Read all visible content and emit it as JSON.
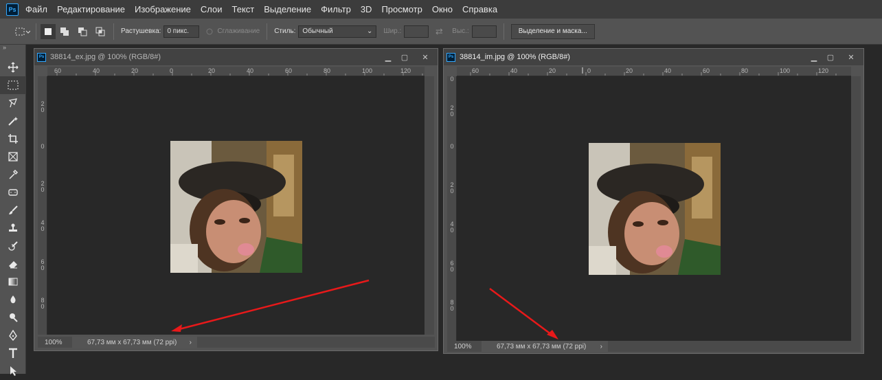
{
  "menu": {
    "items": [
      "Файл",
      "Редактирование",
      "Изображение",
      "Слои",
      "Текст",
      "Выделение",
      "Фильтр",
      "3D",
      "Просмотр",
      "Окно",
      "Справка"
    ],
    "logo": "Ps"
  },
  "options": {
    "feather_label": "Растушевка:",
    "feather_value": "0 пикс.",
    "antialias_label": "Сглаживание",
    "style_label": "Стиль:",
    "style_value": "Обычный",
    "width_label": "Шир.:",
    "height_label": "Выс.:",
    "select_mask_label": "Выделение и маска..."
  },
  "tools": [
    "move-icon",
    "marquee-icon",
    "lasso-icon",
    "magic-wand-icon",
    "crop-icon",
    "frame-icon",
    "eyedropper-icon",
    "healing-brush-icon",
    "brush-icon",
    "clone-stamp-icon",
    "history-brush-icon",
    "eraser-icon",
    "gradient-icon",
    "blur-icon",
    "dodge-icon",
    "pen-icon",
    "type-icon"
  ],
  "windows": [
    {
      "title": "38814_ex.jpg @ 100% (RGB/8#)",
      "zoom": "100%",
      "doc_info": "67,73 мм x 67,73 мм (72 ppi)",
      "ruler_h": [
        "60",
        "40",
        "20",
        "0",
        "20",
        "40",
        "60",
        "80",
        "100",
        "120"
      ],
      "ruler_v": [
        "2\n0",
        "0",
        "2\n0",
        "4\n0",
        "6\n0",
        "8\n0"
      ]
    },
    {
      "title": "38814_im.jpg @ 100% (RGB/8#)",
      "zoom": "100%",
      "doc_info": "67,73 мм x 67,73 мм (72 ppi)",
      "ruler_h": [
        "60",
        "40",
        "20",
        "0",
        "20",
        "40",
        "60",
        "80",
        "100",
        "120"
      ],
      "ruler_v": [
        "0",
        "2\n0",
        "0",
        "2\n0",
        "4\n0",
        "6\n0",
        "8\n0"
      ]
    }
  ],
  "colors": {
    "annotation_arrow": "#e8191a",
    "accent": "#31a8ff"
  }
}
